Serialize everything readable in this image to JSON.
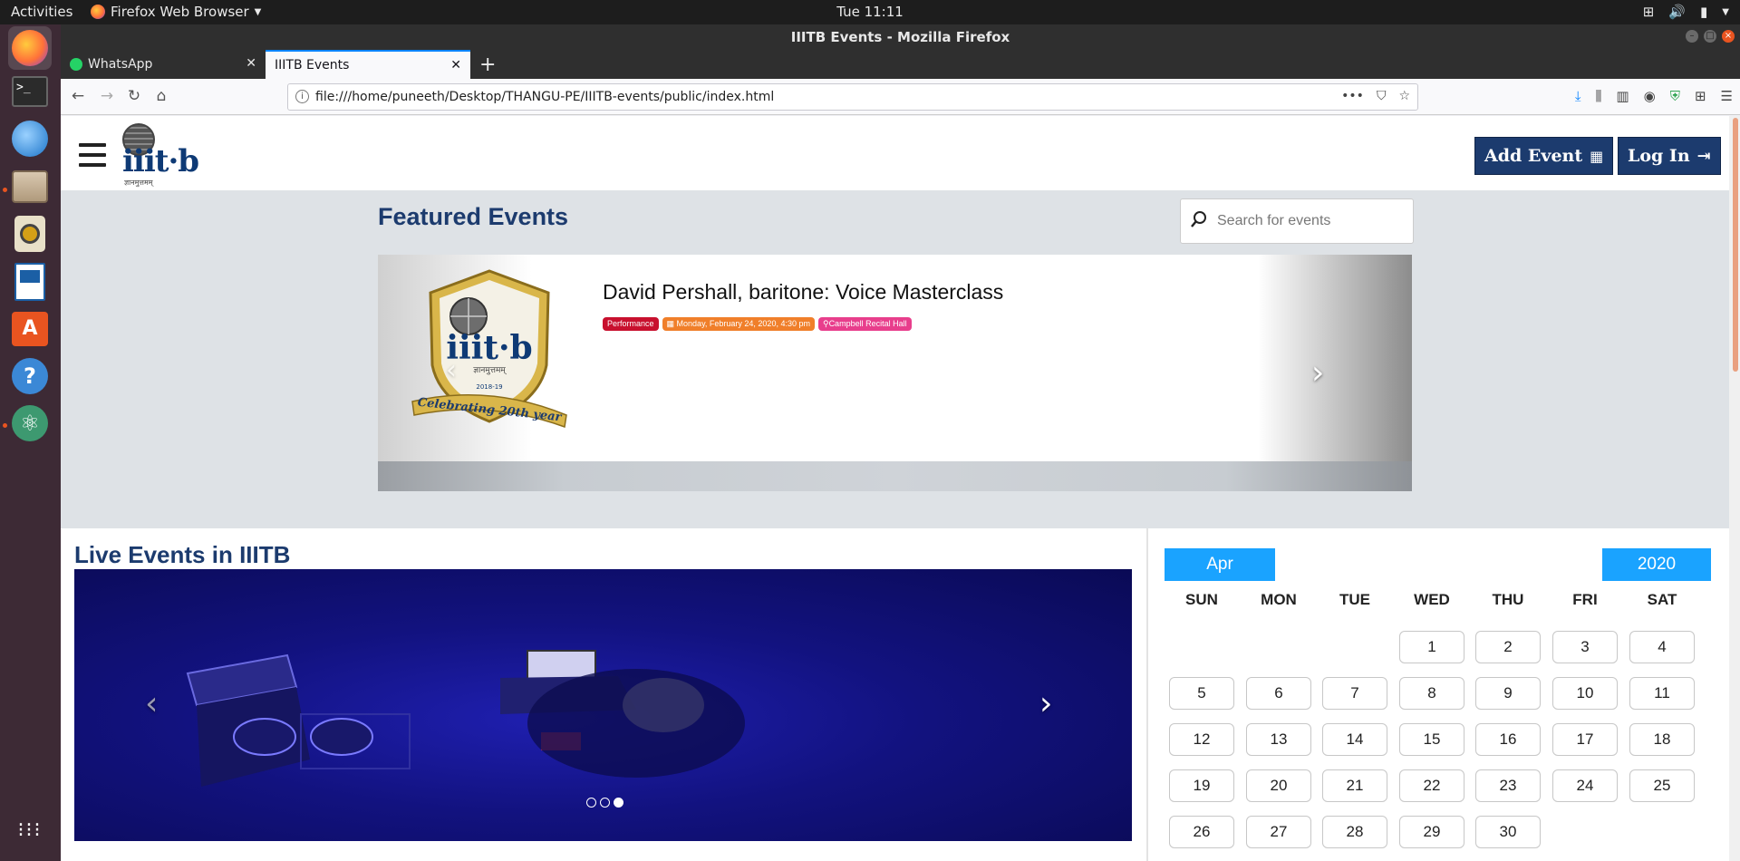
{
  "topbar": {
    "activities": "Activities",
    "app_menu": "Firefox Web Browser",
    "clock": "Tue 11:11"
  },
  "dock": {
    "items": [
      {
        "name": "firefox",
        "icon": "firefox-icon"
      },
      {
        "name": "terminal",
        "icon": "terminal-icon"
      },
      {
        "name": "thunderbird",
        "icon": "mail-icon"
      },
      {
        "name": "files",
        "icon": "files-icon"
      },
      {
        "name": "rhythmbox",
        "icon": "speaker-icon"
      },
      {
        "name": "writer",
        "icon": "document-icon"
      },
      {
        "name": "software",
        "icon": "software-icon"
      },
      {
        "name": "help",
        "icon": "help-icon"
      },
      {
        "name": "atom",
        "icon": "atom-icon"
      },
      {
        "name": "show-apps",
        "icon": "grid-icon"
      }
    ]
  },
  "window": {
    "title": "IIITB Events - Mozilla Firefox"
  },
  "tabs": [
    {
      "label": "WhatsApp"
    },
    {
      "label": "IIITB Events"
    }
  ],
  "navbar": {
    "url": "file:///home/puneeth/Desktop/THANGU-PE/IIITB-events/public/index.html"
  },
  "header": {
    "logo_text": "iiit·b",
    "logo_tagline": "ज्ञानमुत्तमम्",
    "add_event_label": "Add Event",
    "login_label": "Log In"
  },
  "featured": {
    "title": "Featured Events",
    "search_placeholder": "Search for events",
    "event": {
      "title": "David Pershall, baritone: Voice Masterclass",
      "category": "Performance",
      "date": "Monday, February 24, 2020, 4:30 pm",
      "venue": "Campbell Recital Hall",
      "emblem_year": "2018-19",
      "emblem_ribbon": "Celebrating 20th year",
      "emblem_word": "iiit·b",
      "emblem_tagline": "ज्ञानमुत्तमम्"
    },
    "colors": {
      "category": "#c8102e",
      "date": "#f07f2a",
      "venue": "#e83e8c"
    }
  },
  "live": {
    "title": "Live Events in IIITB",
    "slide_count": 3,
    "active_slide": 3
  },
  "calendar": {
    "month": "Apr",
    "year": "2020",
    "weekdays": [
      "SUN",
      "MON",
      "TUE",
      "WED",
      "THU",
      "FRI",
      "SAT"
    ],
    "first_weekday_index": 3,
    "days": [
      "1",
      "2",
      "3",
      "4",
      "5",
      "6",
      "7",
      "8",
      "9",
      "10",
      "11",
      "12",
      "13",
      "14",
      "15",
      "16",
      "17",
      "18",
      "19",
      "20",
      "21",
      "22",
      "23",
      "24",
      "25",
      "26",
      "27",
      "28",
      "29",
      "30"
    ]
  }
}
